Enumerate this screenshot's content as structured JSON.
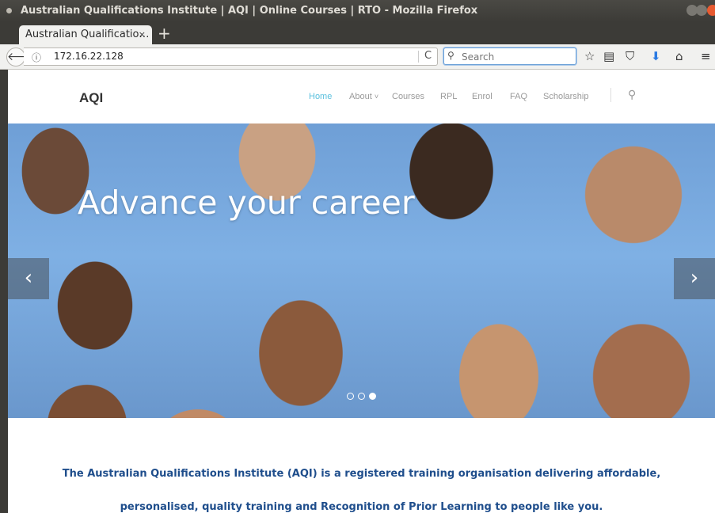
{
  "window": {
    "title": "Australian Qualifications Institute | AQI | Online Courses | RTO - Mozilla Firefox"
  },
  "tabs": [
    {
      "label": "Australian Qualificatio…",
      "close": "×"
    }
  ],
  "new_tab": "+",
  "navbar": {
    "back": "🡐",
    "info": "ⓘ",
    "url": "172.16.22.128",
    "reload": "C",
    "search_placeholder": "Search",
    "icons": [
      "star-icon",
      "reader-icon",
      "pocket-icon",
      "download-icon",
      "home-icon",
      "menu-icon"
    ]
  },
  "site": {
    "logo": "AQI",
    "menu": {
      "home": "Home",
      "about": "About",
      "about_caret": "˅",
      "courses": "Courses",
      "rpl": "RPL",
      "enrol": "Enrol",
      "faq": "FAQ",
      "scholarship": "Scholarship"
    }
  },
  "hero": {
    "title": "Advance your career",
    "prev": "‹",
    "next": "›",
    "active_slide": 3,
    "slide_count": 3
  },
  "intro": {
    "line1": "The Australian Qualifications Institute (AQI) is a registered training organisation delivering affordable,",
    "line2": "personalised, quality training and Recognition of Prior Learning to people like you."
  },
  "colors": {
    "accent": "#5bc0de",
    "intro_text": "#1f4e8c",
    "chrome": "#3c3b37"
  }
}
